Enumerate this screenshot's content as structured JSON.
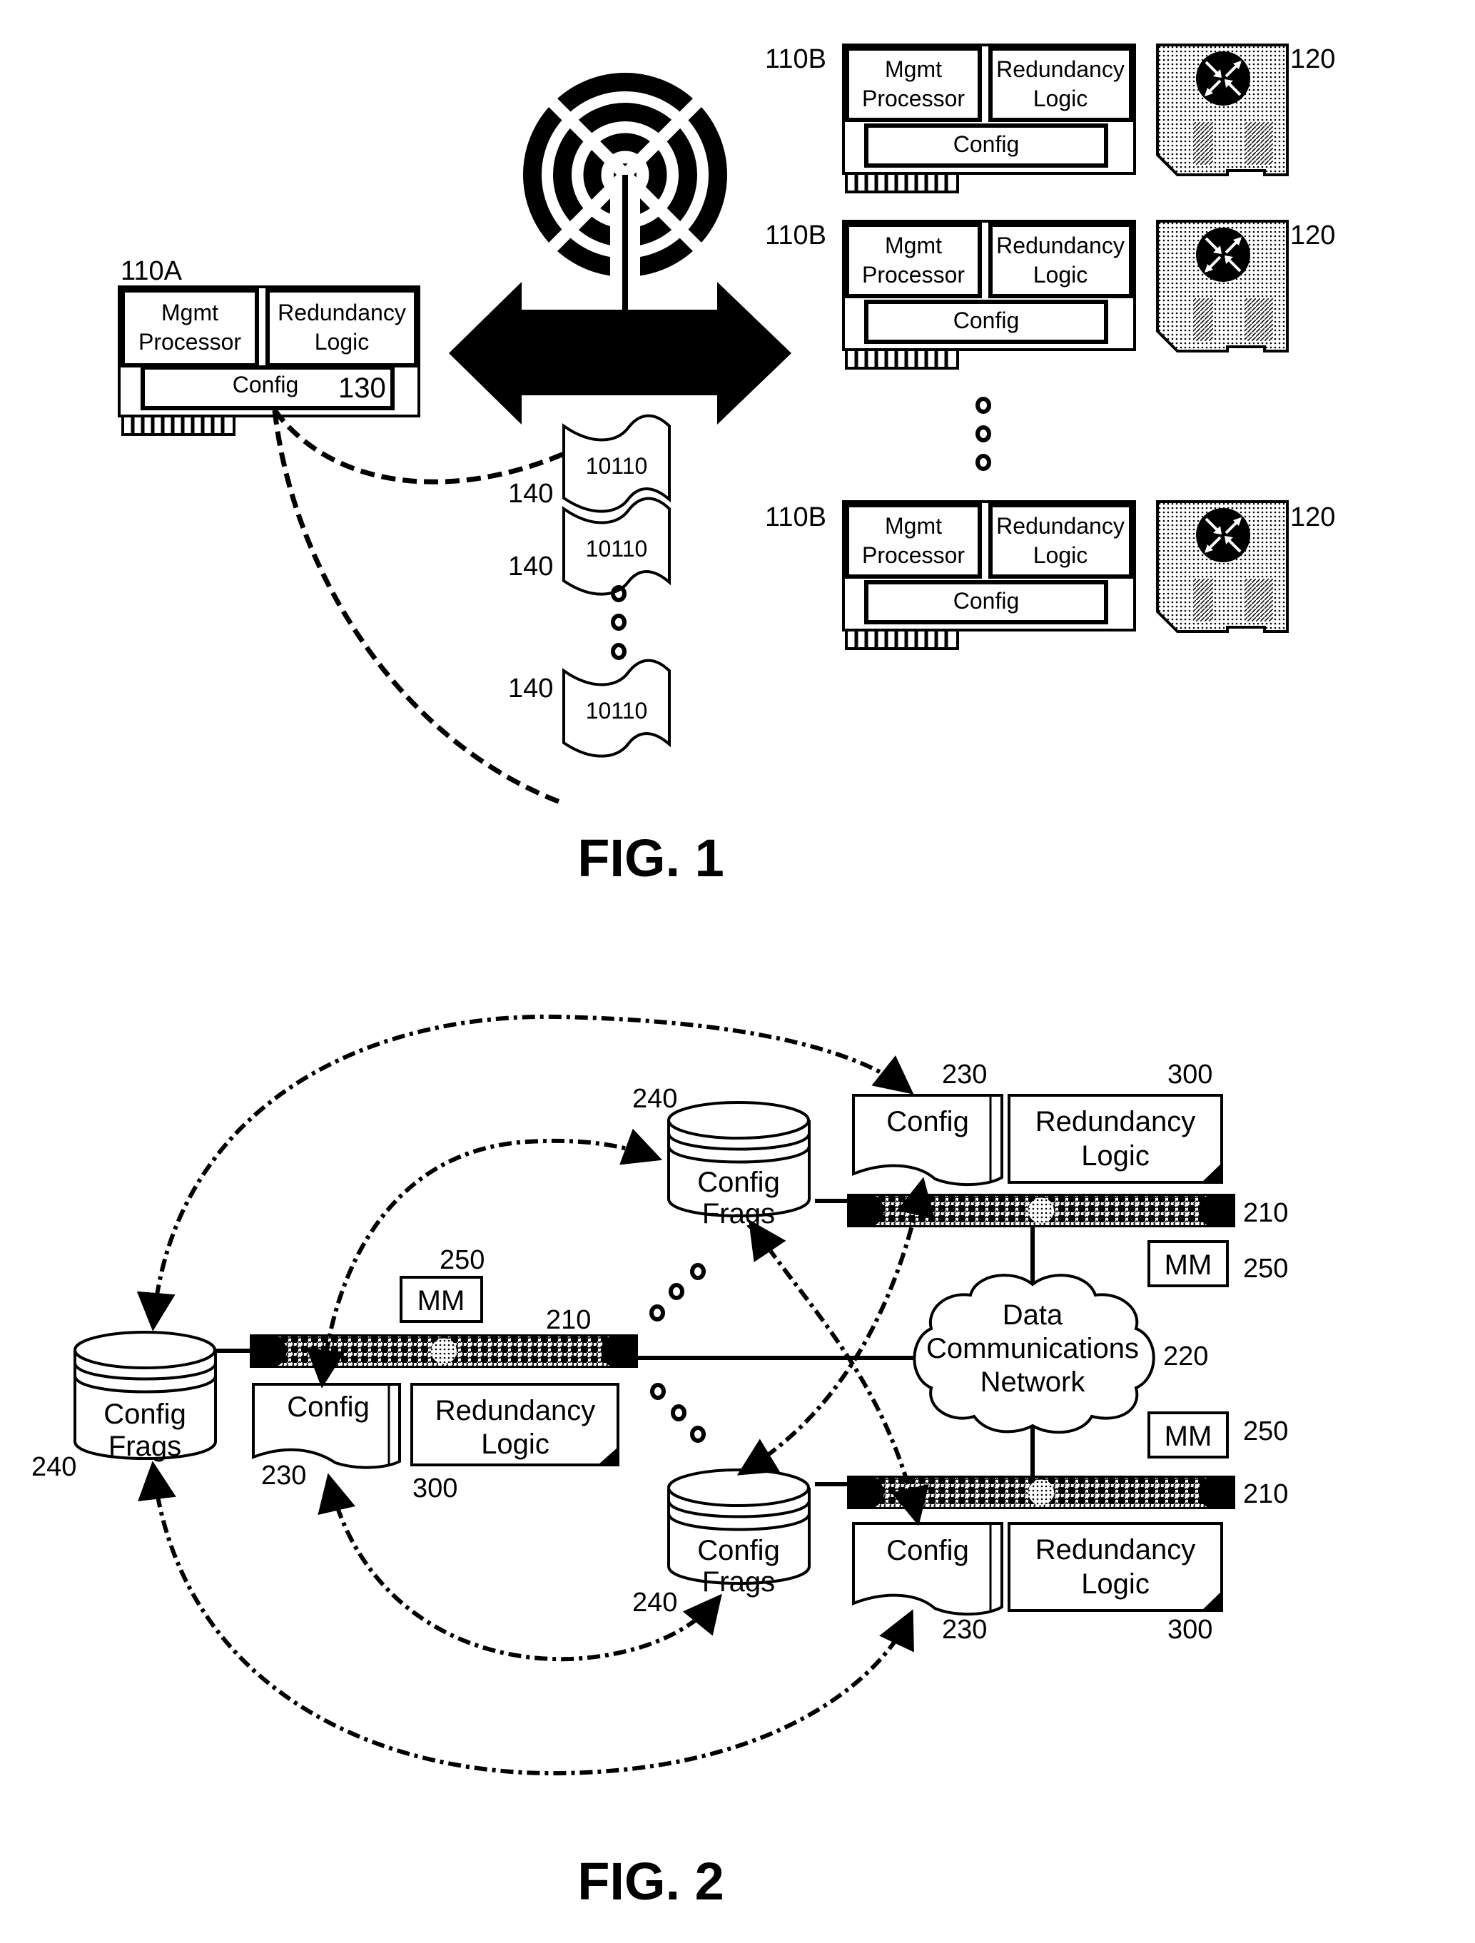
{
  "figure1": {
    "caption": "FIG. 1",
    "primary_card": {
      "ref": "110A",
      "mgmt_line1": "Mgmt",
      "mgmt_line2": "Processor",
      "redundancy_line1": "Redundancy",
      "redundancy_line2": "Logic",
      "config_label": "Config",
      "config_ref": "130"
    },
    "backup_cards": [
      {
        "ref": "110B",
        "mgmt_line1": "Mgmt",
        "mgmt_line2": "Processor",
        "redundancy_line1": "Redundancy",
        "redundancy_line2": "Logic",
        "config_label": "Config",
        "drive_ref": "120"
      },
      {
        "ref": "110B",
        "mgmt_line1": "Mgmt",
        "mgmt_line2": "Processor",
        "redundancy_line1": "Redundancy",
        "redundancy_line2": "Logic",
        "config_label": "Config",
        "drive_ref": "120"
      },
      {
        "ref": "110B",
        "mgmt_line1": "Mgmt",
        "mgmt_line2": "Processor",
        "redundancy_line1": "Redundancy",
        "redundancy_line2": "Logic",
        "config_label": "Config",
        "drive_ref": "120"
      }
    ],
    "fragments": [
      {
        "ref": "140",
        "content": "10110"
      },
      {
        "ref": "140",
        "content": "10110"
      },
      {
        "ref": "140",
        "content": "10110"
      }
    ],
    "icons": [
      "wireless-antenna-icon",
      "bidirectional-arrow-icon",
      "router-drive-icon",
      "ellipsis-dots-icon"
    ]
  },
  "figure2": {
    "caption": "FIG. 2",
    "network": {
      "line1": "Data",
      "line2": "Communications",
      "line3": "Network",
      "ref": "220"
    },
    "nodes": [
      {
        "position": "left",
        "server_ref": "210",
        "mm_label": "MM",
        "mm_ref": "250",
        "config_label": "Config",
        "config_ref": "230",
        "redundancy_line1": "Redundancy",
        "redundancy_line2": "Logic",
        "redundancy_ref": "300",
        "store_line1": "Config",
        "store_line2": "Frags",
        "store_ref": "240"
      },
      {
        "position": "top-right",
        "server_ref": "210",
        "mm_label": "MM",
        "mm_ref": "250",
        "config_label": "Config",
        "config_ref": "230",
        "redundancy_line1": "Redundancy",
        "redundancy_line2": "Logic",
        "redundancy_ref": "300",
        "store_line1": "Config",
        "store_line2": "Frags",
        "store_ref": "240"
      },
      {
        "position": "bottom-right",
        "server_ref": "210",
        "mm_label": "MM",
        "mm_ref": "250",
        "config_label": "Config",
        "config_ref": "230",
        "redundancy_line1": "Redundancy",
        "redundancy_line2": "Logic",
        "redundancy_ref": "300",
        "store_line1": "Config",
        "store_line2": "Frags",
        "store_ref": "240"
      }
    ]
  }
}
